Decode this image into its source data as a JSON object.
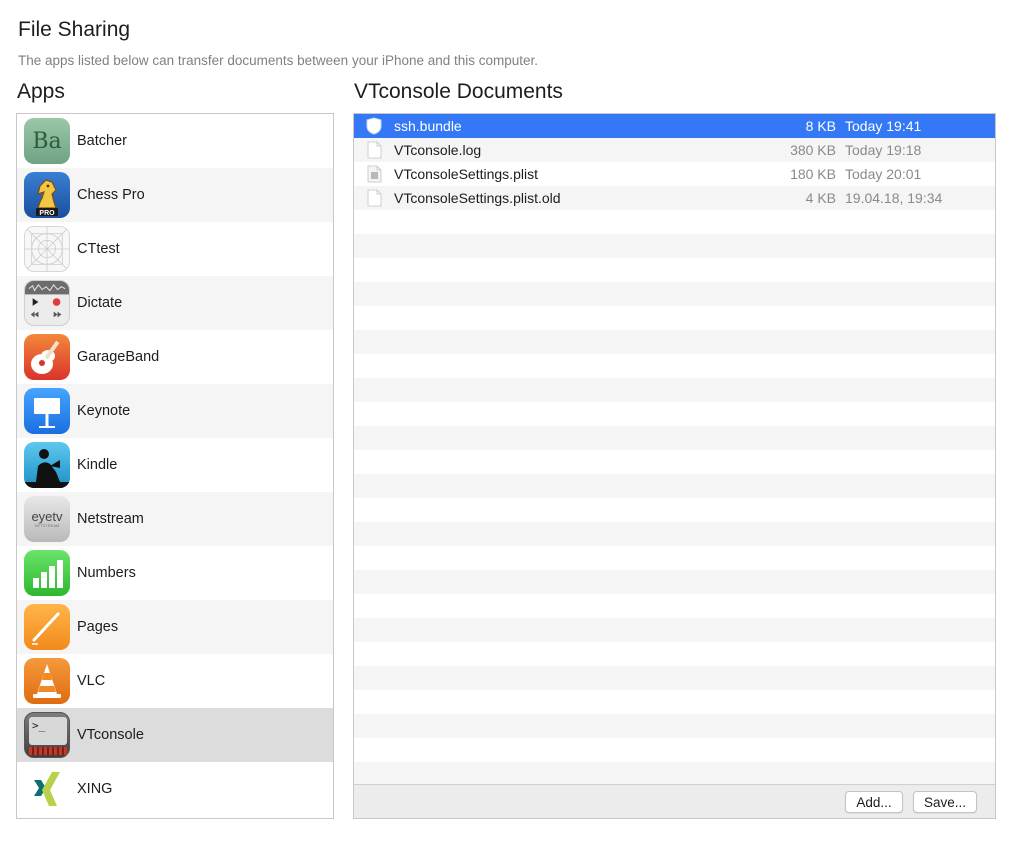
{
  "header": {
    "title": "File Sharing",
    "subtitle": "The apps listed below can transfer documents between your iPhone and this computer."
  },
  "apps": {
    "heading": "Apps",
    "selected": "VTconsole",
    "items": [
      {
        "label": "Batcher",
        "icon": "batcher-icon"
      },
      {
        "label": "Chess Pro",
        "icon": "chess-knight-icon"
      },
      {
        "label": "CTtest",
        "icon": "blank-app-grid-icon"
      },
      {
        "label": "Dictate",
        "icon": "dictate-recorder-icon"
      },
      {
        "label": "GarageBand",
        "icon": "guitar-icon"
      },
      {
        "label": "Keynote",
        "icon": "podium-icon"
      },
      {
        "label": "Kindle",
        "icon": "reader-silhouette-icon"
      },
      {
        "label": "Netstream",
        "icon": "eyetv-icon"
      },
      {
        "label": "Numbers",
        "icon": "bar-chart-icon"
      },
      {
        "label": "Pages",
        "icon": "pen-icon"
      },
      {
        "label": "VLC",
        "icon": "traffic-cone-icon"
      },
      {
        "label": "VTconsole",
        "icon": "terminal-icon"
      },
      {
        "label": "XING",
        "icon": "xing-logo-icon"
      }
    ],
    "icon_text": {
      "batcher": "Ba",
      "chess_pro": "PRO",
      "eyetv": "eyetv",
      "eyetv_sub": "NETSTREAM",
      "terminal": ">_"
    }
  },
  "documents": {
    "heading": "VTconsole Documents",
    "selected": "ssh.bundle",
    "files": [
      {
        "name": "ssh.bundle",
        "size": "8 KB",
        "date": "Today 19:41",
        "icon": "bundle-shield-icon"
      },
      {
        "name": "VTconsole.log",
        "size": "380 KB",
        "date": "Today 19:18",
        "icon": "document-icon"
      },
      {
        "name": "VTconsoleSettings.plist",
        "size": "180 KB",
        "date": "Today 20:01",
        "icon": "plist-document-icon"
      },
      {
        "name": "VTconsoleSettings.plist.old",
        "size": "4 KB",
        "date": "19.04.18, 19:34",
        "icon": "document-icon"
      }
    ],
    "add_label": "Add...",
    "save_label": "Save..."
  },
  "colors": {
    "selection_blue": "#3478f6",
    "selected_app_row": "#dcdcdc",
    "alt_row": "#f5f5f5",
    "secondary_text": "#8a8a8a"
  }
}
